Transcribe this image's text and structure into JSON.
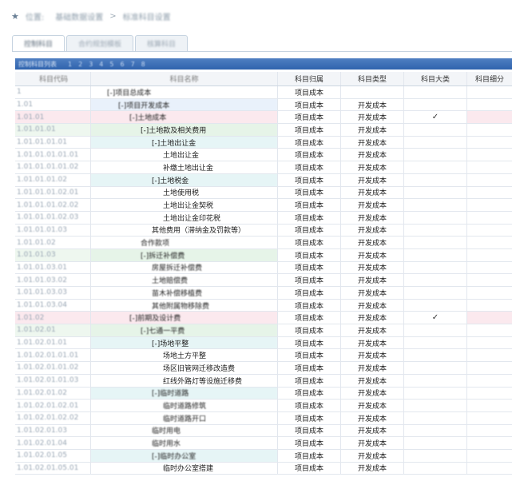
{
  "breadcrumb": {
    "pin_icon": "location-pin-icon",
    "label": "位置:",
    "path1": "基础数据设置",
    "separator": ">",
    "path2": "标准科目设置"
  },
  "tabs": [
    {
      "label": "控制科目"
    },
    {
      "label": "合约规划模板"
    },
    {
      "label": "核算科目"
    }
  ],
  "toolbar": {
    "title": "控制科目列表",
    "pages": [
      "1",
      "2",
      "3",
      "4",
      "5",
      "6",
      "7",
      "8"
    ]
  },
  "columns": [
    "科目代码",
    "科目名称",
    "科目归属",
    "科目类型",
    "科目大类",
    "科目细分"
  ],
  "rows": [
    {
      "code": "1",
      "name": "[-]项目总成本",
      "toggle": true,
      "indent": 0,
      "attr": "项目成本",
      "type": "",
      "big": "",
      "blur": true,
      "bg": ""
    },
    {
      "code": "1.01",
      "name": "[-]项目开发成本",
      "indent": 1,
      "attr": "项目成本",
      "type": "开发成本",
      "big": "",
      "blur": true,
      "bg": "blue"
    },
    {
      "code": "1.01.01",
      "name": "[-]土地成本",
      "indent": 2,
      "attr": "项目成本",
      "type": "开发成本",
      "big": "✓",
      "blur": true,
      "bg": "pink"
    },
    {
      "code": "1.01.01.01",
      "name": "[-]土地款及相关费用",
      "indent": 3,
      "attr": "项目成本",
      "type": "开发成本",
      "big": "",
      "blur": false,
      "bg": "green"
    },
    {
      "code": "1.01.01.01.01",
      "name": "[-]土地出让金",
      "indent": 4,
      "attr": "项目成本",
      "type": "开发成本",
      "big": "",
      "blur": false,
      "bg": "cyan"
    },
    {
      "code": "1.01.01.01.01.01",
      "name": "土地出让金",
      "indent": 5,
      "attr": "项目成本",
      "type": "开发成本",
      "big": "",
      "blur": false,
      "bg": ""
    },
    {
      "code": "1.01.01.01.01.02",
      "name": "补缴土地出让金",
      "indent": 5,
      "attr": "项目成本",
      "type": "开发成本",
      "big": "",
      "blur": false,
      "bg": ""
    },
    {
      "code": "1.01.01.01.02",
      "name": "[-]土地税金",
      "indent": 4,
      "attr": "项目成本",
      "type": "开发成本",
      "big": "",
      "blur": false,
      "bg": "cyan"
    },
    {
      "code": "1.01.01.01.02.01",
      "name": "土地使用税",
      "indent": 5,
      "attr": "项目成本",
      "type": "开发成本",
      "big": "",
      "blur": false,
      "bg": ""
    },
    {
      "code": "1.01.01.01.02.02",
      "name": "土地出让金契税",
      "indent": 5,
      "attr": "项目成本",
      "type": "开发成本",
      "big": "",
      "blur": false,
      "bg": ""
    },
    {
      "code": "1.01.01.01.02.03",
      "name": "土地出让金印花税",
      "indent": 5,
      "attr": "项目成本",
      "type": "开发成本",
      "big": "",
      "blur": false,
      "bg": ""
    },
    {
      "code": "1.01.01.01.03",
      "name": "其他费用（滞纳金及罚款等）",
      "indent": 4,
      "attr": "项目成本",
      "type": "开发成本",
      "big": "",
      "blur": false,
      "bg": ""
    },
    {
      "code": "1.01.01.02",
      "name": "合作款项",
      "indent": 3,
      "attr": "项目成本",
      "type": "开发成本",
      "big": "",
      "blur": true,
      "bg": ""
    },
    {
      "code": "1.01.01.03",
      "name": "[-]拆迁补偿费",
      "indent": 3,
      "attr": "项目成本",
      "type": "开发成本",
      "big": "",
      "blur": true,
      "bg": "green"
    },
    {
      "code": "1.01.01.03.01",
      "name": "房屋拆迁补偿费",
      "indent": 4,
      "attr": "项目成本",
      "type": "开发成本",
      "big": "",
      "blur": true,
      "bg": ""
    },
    {
      "code": "1.01.01.03.02",
      "name": "土地赔偿费",
      "indent": 4,
      "attr": "项目成本",
      "type": "开发成本",
      "big": "",
      "blur": true,
      "bg": ""
    },
    {
      "code": "1.01.01.03.03",
      "name": "苗木补偿移植费",
      "indent": 4,
      "attr": "项目成本",
      "type": "开发成本",
      "big": "",
      "blur": true,
      "bg": ""
    },
    {
      "code": "1.01.01.03.04",
      "name": "其他附属物移除费",
      "indent": 4,
      "attr": "项目成本",
      "type": "开发成本",
      "big": "",
      "blur": true,
      "bg": ""
    },
    {
      "code": "1.01.02",
      "name": "[-]前期及设计费",
      "indent": 2,
      "attr": "项目成本",
      "type": "开发成本",
      "big": "✓",
      "blur": true,
      "bg": "pink"
    },
    {
      "code": "1.01.02.01",
      "name": "[-]七通一平费",
      "indent": 3,
      "attr": "项目成本",
      "type": "开发成本",
      "big": "",
      "blur": true,
      "bg": "green"
    },
    {
      "code": "1.01.02.01.01",
      "name": "[-]场地平整",
      "indent": 4,
      "attr": "项目成本",
      "type": "开发成本",
      "big": "",
      "blur": false,
      "bg": "cyan"
    },
    {
      "code": "1.01.02.01.01.01",
      "name": "场地土方平整",
      "indent": 5,
      "attr": "项目成本",
      "type": "开发成本",
      "big": "",
      "blur": false,
      "bg": ""
    },
    {
      "code": "1.01.02.01.01.02",
      "name": "场区旧管网迁移改造费",
      "indent": 5,
      "attr": "项目成本",
      "type": "开发成本",
      "big": "",
      "blur": false,
      "bg": ""
    },
    {
      "code": "1.01.02.01.01.03",
      "name": "红线外路灯等设施迁移费",
      "indent": 5,
      "attr": "项目成本",
      "type": "开发成本",
      "big": "",
      "blur": false,
      "bg": ""
    },
    {
      "code": "1.01.02.01.02",
      "name": "[-]临时道路",
      "indent": 4,
      "attr": "项目成本",
      "type": "开发成本",
      "big": "",
      "blur": true,
      "bg": "cyan"
    },
    {
      "code": "1.01.02.01.02.01",
      "name": "临时道路修筑",
      "indent": 5,
      "attr": "项目成本",
      "type": "开发成本",
      "big": "",
      "blur": true,
      "bg": ""
    },
    {
      "code": "1.01.02.01.02.02",
      "name": "临时道路开口",
      "indent": 5,
      "attr": "项目成本",
      "type": "开发成本",
      "big": "",
      "blur": true,
      "bg": ""
    },
    {
      "code": "1.01.02.01.03",
      "name": "临时用电",
      "indent": 4,
      "attr": "项目成本",
      "type": "开发成本",
      "big": "",
      "blur": true,
      "bg": ""
    },
    {
      "code": "1.01.02.01.04",
      "name": "临时用水",
      "indent": 4,
      "attr": "项目成本",
      "type": "开发成本",
      "big": "",
      "blur": true,
      "bg": ""
    },
    {
      "code": "1.01.02.01.05",
      "name": "[-]临时办公室",
      "indent": 4,
      "attr": "项目成本",
      "type": "开发成本",
      "big": "",
      "blur": true,
      "bg": "cyan"
    },
    {
      "code": "1.01.02.01.05.01",
      "name": "临时办公室搭建",
      "indent": 5,
      "attr": "项目成本",
      "type": "开发成本",
      "big": "",
      "blur": false,
      "bg": ""
    }
  ]
}
